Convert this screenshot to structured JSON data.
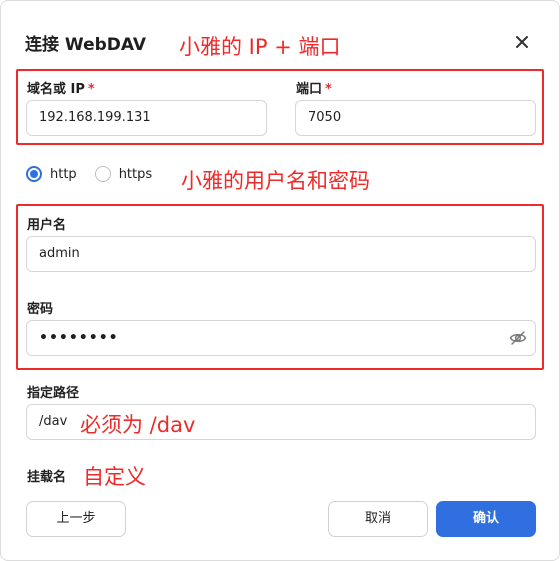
{
  "dialog": {
    "title": "连接 WebDAV",
    "close_icon": "close-icon"
  },
  "form": {
    "host_label": "域名或 IP",
    "host_required": "*",
    "host_value": "192.168.199.131",
    "port_label": "端口",
    "port_required": "*",
    "port_value": "7050",
    "protocol": {
      "options": [
        "http",
        "https"
      ],
      "selected": "http"
    },
    "username_label": "用户名",
    "username_value": "admin",
    "password_label": "密码",
    "password_value": "••••••••",
    "password_toggle_icon": "eye-off-icon",
    "path_label": "指定路径",
    "path_value": "/dav",
    "mount_name_label": "挂载名"
  },
  "footer": {
    "back_label": "上一步",
    "cancel_label": "取消",
    "confirm_label": "确认"
  },
  "annotations": {
    "ip_port": "小雅的 IP + 端口",
    "credentials": "小雅的用户名和密码",
    "path": "必须为 /dav",
    "mount_name": "自定义"
  },
  "colors": {
    "accent": "#2f6fe0",
    "required": "#e0303a",
    "annotation": "#ee2a2a"
  }
}
